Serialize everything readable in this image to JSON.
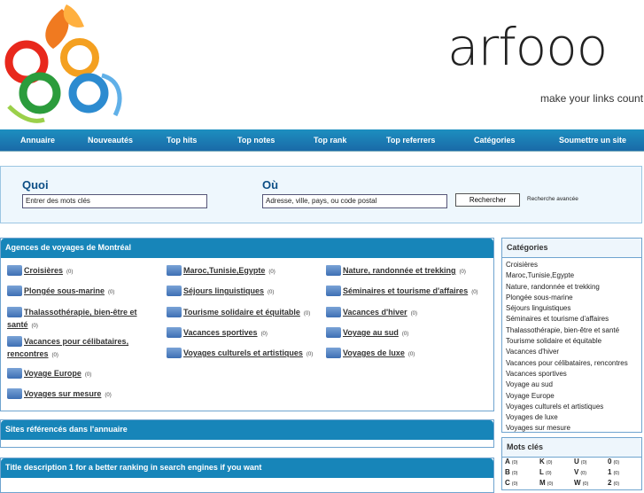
{
  "brand": {
    "name": "arfooo",
    "tagline": "make your links count"
  },
  "nav": [
    "Annuaire",
    "Nouveautés",
    "Top hits",
    "Top notes",
    "Top rank",
    "Top referrers",
    "Catégories",
    "Soumettre un site"
  ],
  "search": {
    "what_label": "Quoi",
    "what_placeholder": "Entrer des mots clés",
    "where_label": "Où",
    "where_placeholder": "Adresse, ville, pays, ou code postal",
    "button": "Rechercher",
    "advanced": "Recherche avancée"
  },
  "main": {
    "title": "Agences de voyages de Montréal",
    "columns": [
      [
        {
          "label": "Croisières",
          "count": "(0)"
        },
        {
          "label": "Plongée sous-marine",
          "count": "(0)"
        },
        {
          "label": "Thalassothérapie, bien-être et santé",
          "count": "(0)"
        },
        {
          "label": "Vacances pour célibataires, rencontres",
          "count": "(0)"
        },
        {
          "label": "Voyage Europe",
          "count": "(0)"
        },
        {
          "label": "Voyages sur mesure",
          "count": "(0)"
        }
      ],
      [
        {
          "label": "Maroc,Tunisie,Egypte",
          "count": "(0)"
        },
        {
          "label": "Séjours linguistiques",
          "count": "(0)"
        },
        {
          "label": "Tourisme solidaire et équitable",
          "count": "(0)"
        },
        {
          "label": "Vacances sportives",
          "count": "(0)"
        },
        {
          "label": "Voyages culturels et artistiques",
          "count": "(0)"
        }
      ],
      [
        {
          "label": "Nature, randonnée et trekking",
          "count": "(0)"
        },
        {
          "label": "Séminaires et tourisme d'affaires",
          "count": "(0)"
        },
        {
          "label": "Vacances d'hiver",
          "count": "(0)"
        },
        {
          "label": "Voyage au sud",
          "count": "(0)"
        },
        {
          "label": "Voyages de luxe",
          "count": "(0)"
        }
      ]
    ]
  },
  "sites": {
    "title": "Sites référencés dans l'annuaire"
  },
  "desc": {
    "title": "Title description 1 for a better ranking in search engines if you want"
  },
  "sidebar": {
    "title": "Catégories",
    "items": [
      "Croisières",
      "Maroc,Tunisie,Egypte",
      "Nature, randonnée et trekking",
      "Plongée sous-marine",
      "Séjours linguistiques",
      "Séminaires et tourisme d'affaires",
      "Thalassothérapie, bien-être et santé",
      "Tourisme solidaire et équitable",
      "Vacances d'hiver",
      "Vacances pour célibataires, rencontres",
      "Vacances sportives",
      "Voyage au sud",
      "Voyage Europe",
      "Voyages culturels et artistiques",
      "Voyages de luxe",
      "Voyages sur mesure"
    ]
  },
  "keywords": {
    "title": "Mots clés",
    "rows": [
      [
        {
          "k": "A",
          "c": "(0)"
        },
        {
          "k": "K",
          "c": "(0)"
        },
        {
          "k": "U",
          "c": "(0)"
        },
        {
          "k": "0",
          "c": "(0)"
        }
      ],
      [
        {
          "k": "B",
          "c": "(0)"
        },
        {
          "k": "L",
          "c": "(0)"
        },
        {
          "k": "V",
          "c": "(0)"
        },
        {
          "k": "1",
          "c": "(0)"
        }
      ],
      [
        {
          "k": "C",
          "c": "(0)"
        },
        {
          "k": "M",
          "c": "(0)"
        },
        {
          "k": "W",
          "c": "(0)"
        },
        {
          "k": "2",
          "c": "(0)"
        }
      ]
    ]
  }
}
